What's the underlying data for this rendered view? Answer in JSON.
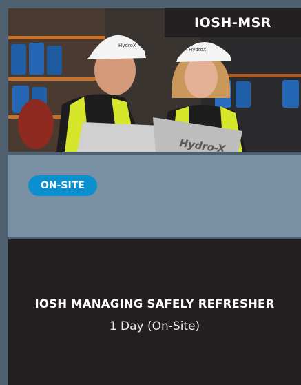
{
  "card": {
    "code": "IOSH-MSR",
    "badge": "ON-SITE",
    "title": "IOSH MANAGING SAFELY REFRESHER",
    "subtitle": "1 Day (On-Site)",
    "photo": {
      "helmet_text_left": "HydroX",
      "helmet_text_right": "HydroX",
      "binder_text": "Hydro-X"
    }
  },
  "colors": {
    "frame": "#4f6070",
    "code_bg": "#231f20",
    "mid_band": "#7a90a5",
    "badge": "#0b8fcf",
    "bottom_panel": "#231f20",
    "hi_vis": "#d6e62a"
  }
}
